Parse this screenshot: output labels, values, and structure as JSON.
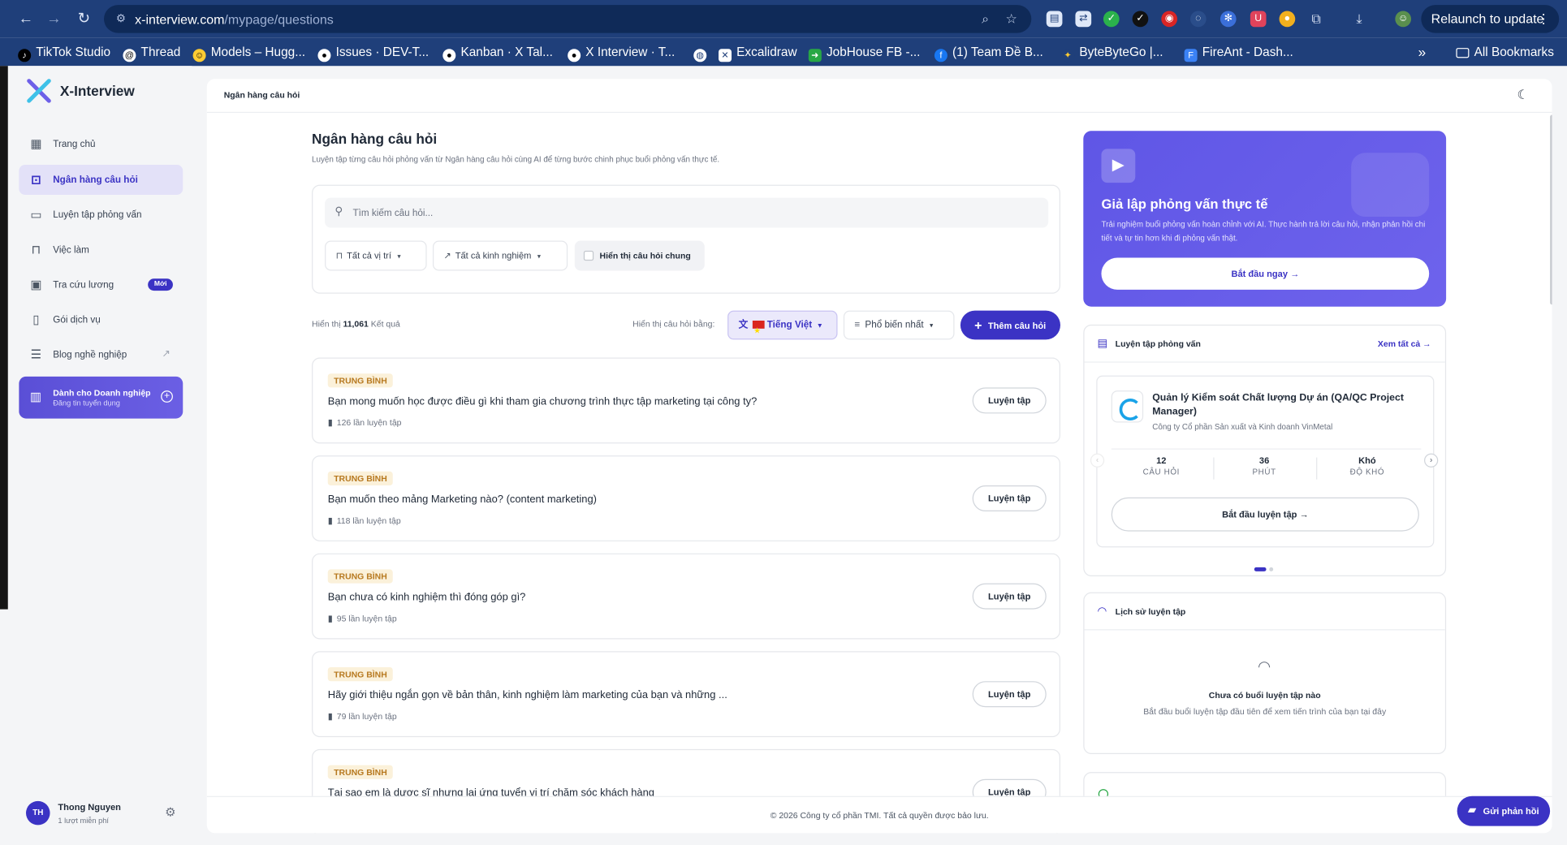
{
  "browser": {
    "url_domain": "x-interview.com",
    "url_path": "/mypage/questions",
    "relaunch_label": "Relaunch to update",
    "bookmarks": [
      "TikTok Studio",
      "Thread",
      "Models – Hugg...",
      "Issues · DEV-T...",
      "Kanban · X Tal...",
      "X Interview · T...",
      "",
      "Excalidraw",
      "JobHouse FB -...",
      "(1) Team Đề B...",
      "ByteByteGo |...",
      "FireAnt - Dash..."
    ],
    "more_label": "»",
    "all_bookmarks_label": "All Bookmarks"
  },
  "app": {
    "name": "X-Interview",
    "breadcrumb": "Ngân hàng câu hỏi",
    "footer": "© 2026 Công ty cổ phần TMI. Tất cả quyền được bảo lưu."
  },
  "sidebar": {
    "items": [
      {
        "label": "Trang chủ",
        "icon": "dashboard-icon"
      },
      {
        "label": "Ngân hàng câu hỏi",
        "icon": "question-bank-icon",
        "active": true
      },
      {
        "label": "Luyện tập phỏng vấn",
        "icon": "video-icon"
      },
      {
        "label": "Việc làm",
        "icon": "briefcase-icon"
      },
      {
        "label": "Tra cứu lương",
        "icon": "salary-icon",
        "badge": "Mới"
      },
      {
        "label": "Gói dịch vụ",
        "icon": "clipboard-icon"
      },
      {
        "label": "Blog nghề nghiệp",
        "icon": "blog-icon",
        "external": true
      }
    ],
    "business": {
      "title": "Dành cho Doanh nghiệp",
      "subtitle": "Đăng tin tuyển dụng"
    },
    "user": {
      "initials": "TH",
      "name": "Thong Nguyen",
      "plan": "1 lượt miễn phí"
    }
  },
  "page": {
    "title": "Ngân hàng câu hỏi",
    "subtitle": "Luyện tập từng câu hỏi phỏng vấn từ Ngân hàng câu hỏi cùng AI để từng bước chinh phục buổi phỏng vấn thực tế.",
    "search_placeholder": "Tìm kiếm câu hỏi...",
    "filter_position": "Tất cả vị trí",
    "filter_experience": "Tất cả kinh nghiệm",
    "show_common_label": "Hiển thị câu hỏi chung",
    "results_prefix": "Hiển thị",
    "results_count": "11,061",
    "results_suffix": "Kết quả",
    "language_label": "Hiển thị câu hỏi bằng:",
    "language_value": "Tiếng Việt",
    "sort_value": "Phổ biến nhất",
    "add_question_label": "Thêm câu hỏi"
  },
  "questions": [
    {
      "level": "TRUNG BÌNH",
      "text": "Bạn mong muốn học được điều gì khi tham gia chương trình thực tập marketing tại công ty?",
      "practice": "126 lần luyện tập",
      "button": "Luyện tập"
    },
    {
      "level": "TRUNG BÌNH",
      "text": "Bạn muốn theo mảng Marketing nào? (content marketing)",
      "practice": "118 lần luyện tập",
      "button": "Luyện tập"
    },
    {
      "level": "TRUNG BÌNH",
      "text": "Bạn chưa có kinh nghiệm thì đóng góp gì?",
      "practice": "95 lần luyện tập",
      "button": "Luyện tập"
    },
    {
      "level": "TRUNG BÌNH",
      "text": "Hãy giới thiệu ngắn gọn về bản thân, kinh nghiệm làm marketing của bạn và những ...",
      "practice": "79 lần luyện tập",
      "button": "Luyện tập"
    },
    {
      "level": "TRUNG BÌNH",
      "text": "Tại sao em là dược sĩ nhưng lại ứng tuyển vị trí chăm sóc khách hàng",
      "practice": "",
      "button": "Luyện tập"
    }
  ],
  "promo": {
    "title": "Giả lập phỏng vấn thực tế",
    "desc": "Trải nghiệm buổi phỏng vấn hoàn chỉnh với AI. Thực hành trả lời câu hỏi, nhận phản hồi chi tiết và tự tin hơn khi đi phỏng vấn thật.",
    "button": "Bắt đầu ngay"
  },
  "practice_panel": {
    "title": "Luyện tập phỏng vấn",
    "see_all": "Xem tất cả",
    "card": {
      "title": "Quản lý Kiểm soát Chất lượng Dự án (QA/QC Project Manager)",
      "company": "Công ty Cổ phần Sản xuất và Kinh doanh VinMetal",
      "stats": [
        {
          "value": "12",
          "label": "CÂU HỎI"
        },
        {
          "value": "36",
          "label": "PHÚT"
        },
        {
          "value": "Khó",
          "label": "ĐỘ KHÓ"
        }
      ],
      "button": "Bắt đầu luyện tập"
    }
  },
  "history_panel": {
    "title": "Lịch sử luyện tập",
    "empty_title": "Chưa có buổi luyện tập nào",
    "empty_desc": "Bắt đầu buổi luyện tập đầu tiên để xem tiến trình của bạn tại đây"
  },
  "feedback_label": "Gửi phản hồi",
  "colors": {
    "brand": "#3b33c4",
    "browser_bar": "#1f3f7a",
    "level_badge": "#b7791f"
  }
}
